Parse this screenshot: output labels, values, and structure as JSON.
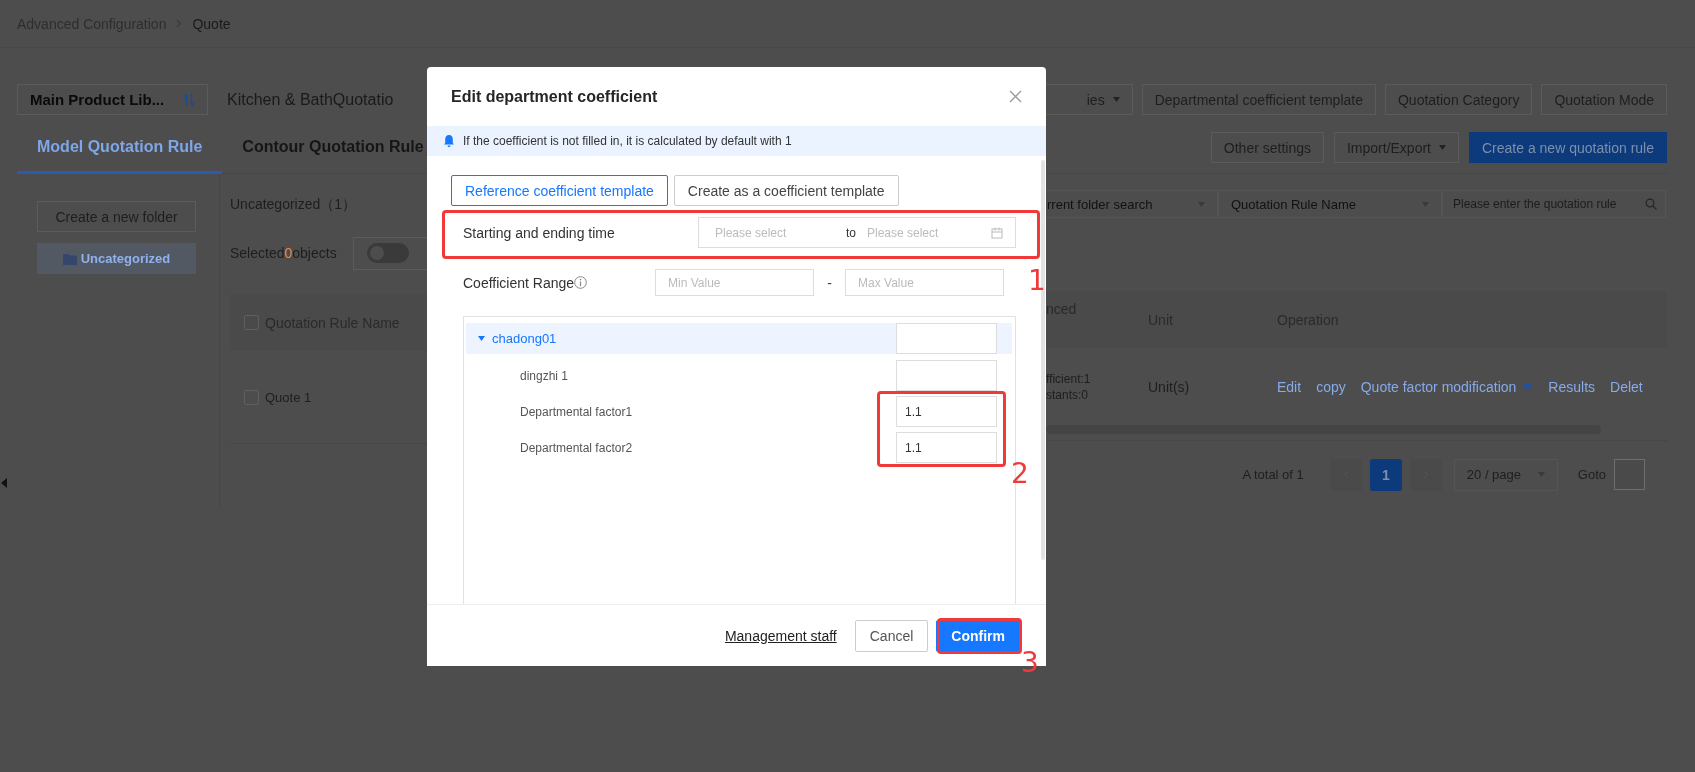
{
  "breadcrumb": [
    {
      "label": "Advanced Configuration",
      "selected": false
    },
    {
      "label": "Quote",
      "selected": true
    }
  ],
  "library_select": {
    "value": "Main Product Lib..."
  },
  "library_name": "Kitchen & BathQuotatio",
  "top_buttons": [
    {
      "label": "ies",
      "dropdown": true
    },
    {
      "label": "Departmental coefficient template",
      "dropdown": false
    },
    {
      "label": "Quotation Category",
      "dropdown": false
    },
    {
      "label": "Quotation Mode",
      "dropdown": false
    }
  ],
  "tabs": [
    {
      "label": "Model Quotation Rule",
      "selected": true
    },
    {
      "label": "Contour Quotation Rule",
      "selected": false
    }
  ],
  "action_buttons": [
    {
      "label": "Other settings",
      "kind": "default"
    },
    {
      "label": "Import/Export",
      "kind": "dropdown"
    },
    {
      "label": "Create a new quotation rule",
      "kind": "primary"
    }
  ],
  "sidebar": {
    "new_folder_button": "Create a new folder",
    "folders": [
      {
        "label": "Uncategorized",
        "selected": true
      }
    ]
  },
  "folder_title": "Uncategorized（1）",
  "selection": {
    "prefix": "Selected",
    "count": "0",
    "suffix": "objects",
    "toggle_on": false
  },
  "filters": [
    {
      "value": "rrent folder search"
    },
    {
      "value": "Quotation Rule Name"
    }
  ],
  "search": {
    "placeholder": "Please enter the quotation rule"
  },
  "table": {
    "name_column": "Quotation Rule Name",
    "header_checked": false,
    "columns_right": [
      "nced",
      "Unit",
      "Operation"
    ],
    "rows": [
      {
        "checked": false,
        "name": "Quote 1",
        "column_cut": [
          "fficient:1",
          "stants:0"
        ],
        "unit": "Unit(s)",
        "actions": [
          {
            "label": "Edit",
            "dropdown": false
          },
          {
            "label": "copy",
            "dropdown": false
          },
          {
            "label": "Quote factor modification",
            "dropdown": true
          },
          {
            "label": "Results",
            "dropdown": false
          },
          {
            "label": "Delet",
            "dropdown": false
          }
        ]
      }
    ]
  },
  "pagination": {
    "total": "A total of 1",
    "pages": [
      {
        "label": "1",
        "selected": true
      }
    ],
    "page_size": "20 / page",
    "goto": "Goto"
  },
  "dialog": {
    "title": "Edit department coefficient",
    "notice": "If the coefficient is not filled in, it is calculated by default with 1",
    "template_buttons": [
      {
        "label": "Reference coefficient template",
        "selected": true
      },
      {
        "label": "Create as a coefficient template",
        "selected": false
      }
    ],
    "time_range": {
      "label": "Starting and ending time",
      "start_placeholder": "Please select",
      "separator": "to",
      "end_placeholder": "Please select"
    },
    "coefficient_range": {
      "label": "Coefficient Range",
      "min_placeholder": "Min Value",
      "separator": "-",
      "max_placeholder": "Max Value"
    },
    "tree": [
      {
        "label": "chadong01",
        "expanded": true,
        "selected": true,
        "children": [
          {
            "label": "dingzhi 1"
          },
          {
            "label": "Departmental factor1",
            "value": "1.1"
          },
          {
            "label": "Departmental factor2",
            "value": "1.1"
          }
        ]
      }
    ],
    "footer": {
      "link": "Management staff",
      "buttons": [
        {
          "label": "Cancel",
          "kind": "default"
        },
        {
          "label": "Confirm",
          "kind": "primary"
        }
      ]
    },
    "annotations": [
      {
        "number": "1"
      },
      {
        "number": "2"
      },
      {
        "number": "3"
      }
    ]
  }
}
